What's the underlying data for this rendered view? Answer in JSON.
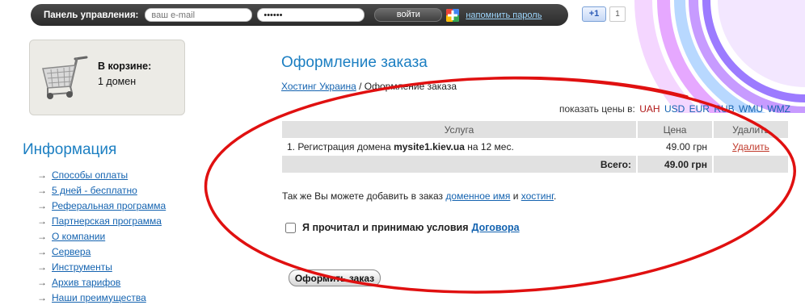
{
  "topbar": {
    "panel_label": "Панель управления:",
    "email_placeholder": "ваш e-mail",
    "password_value": "••••••",
    "login_label": "войти",
    "remind_label": "напомнить пароль"
  },
  "social": {
    "plusone_label": "+1",
    "plusone_count": "1"
  },
  "cart": {
    "title": "В корзине:",
    "count_text": "1 домен"
  },
  "sidebar": {
    "heading": "Информация",
    "arrow": "→",
    "items": [
      "Способы оплаты",
      "5 дней - бесплатно",
      "Реферальная программа",
      "Партнерская программа",
      "О компании",
      "Сервера",
      "Инструменты",
      "Архив тарифов",
      "Наши преимущества"
    ]
  },
  "main": {
    "title": "Оформление заказа",
    "breadcrumb": {
      "link": "Хостинг Украина",
      "separator": " / ",
      "current": "Оформление заказа"
    },
    "currency": {
      "label": "показать цены в:",
      "options": [
        "UAH",
        "USD",
        "EUR",
        "RUB",
        "WMU",
        "WMZ"
      ],
      "active": "UAH"
    },
    "table": {
      "headers": {
        "service": "Услуга",
        "price": "Цена",
        "delete": "Удалить"
      },
      "rows": [
        {
          "prefix": "1. Регистрация домена ",
          "domain": "mysite1.kiev.ua",
          "suffix": " на 12 мес.",
          "price": "49.00 грн",
          "delete_label": "Удалить"
        }
      ],
      "total_label": "Всего:",
      "total_value": "49.00 грн"
    },
    "add_note": {
      "prefix": "Так же Вы можете добавить в заказ ",
      "link1": "доменное имя",
      "middle": " и ",
      "link2": "хостинг",
      "suffix": "."
    },
    "agree": {
      "text": "Я прочитал и принимаю условия",
      "link": "Договора"
    },
    "submit_label": "Оформить заказ"
  },
  "colors": {
    "heading_blue": "#1c7fc2",
    "link_blue": "#1463b0",
    "delete_red": "#c0392b",
    "annotation_red": "#e01010"
  }
}
